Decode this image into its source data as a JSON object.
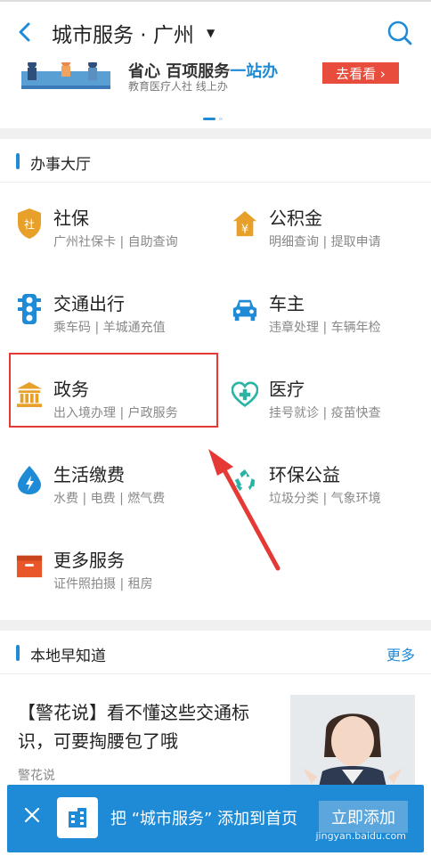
{
  "header": {
    "title": "城市服务 · 广州",
    "caret": "▼"
  },
  "banner": {
    "title_part1": "省心 百项服务",
    "title_part2": "一站办",
    "subtitle": "教育医疗人社 线上办",
    "button": "去看看 ›"
  },
  "hall": {
    "title": "办事大厅",
    "items": [
      {
        "name": "社保",
        "sub": "广州社保卡 | 自助查询",
        "icon": "shield-icon",
        "color": "#e7a12a"
      },
      {
        "name": "公积金",
        "sub": "明细查询 | 提取申请",
        "icon": "yuan-house-icon",
        "color": "#e7a12a"
      },
      {
        "name": "交通出行",
        "sub": "乘车码 | 羊城通充值",
        "icon": "traffic-light-icon",
        "color": "#1f8bd6"
      },
      {
        "name": "车主",
        "sub": "违章处理 | 车辆年检",
        "icon": "car-icon",
        "color": "#1f8bd6"
      },
      {
        "name": "政务",
        "sub": "出入境办理 | 户政服务",
        "icon": "government-building-icon",
        "color": "#e7a12a"
      },
      {
        "name": "医疗",
        "sub": "挂号就诊 | 疫苗快查",
        "icon": "medical-heart-icon",
        "color": "#2bb3a3"
      },
      {
        "name": "生活缴费",
        "sub": "水费 | 电费 | 燃气费",
        "icon": "water-drop-icon",
        "color": "#1f8bd6"
      },
      {
        "name": "环保公益",
        "sub": "垃圾分类 | 气象环境",
        "icon": "recycle-icon",
        "color": "#2bb3a3"
      },
      {
        "name": "更多服务",
        "sub": "证件照拍摄 | 租房",
        "icon": "box-icon",
        "color": "#e8562a"
      }
    ]
  },
  "local": {
    "title": "本地早知道",
    "more": "更多",
    "news_title": "【警花说】看不懂这些交通标识，可要掏腰包了哦",
    "news_source": "警花说"
  },
  "bottom_bar": {
    "text": "把 “城市服务” 添加到首页",
    "button": "立即添加"
  },
  "watermark": "jingyan.baidu.com"
}
